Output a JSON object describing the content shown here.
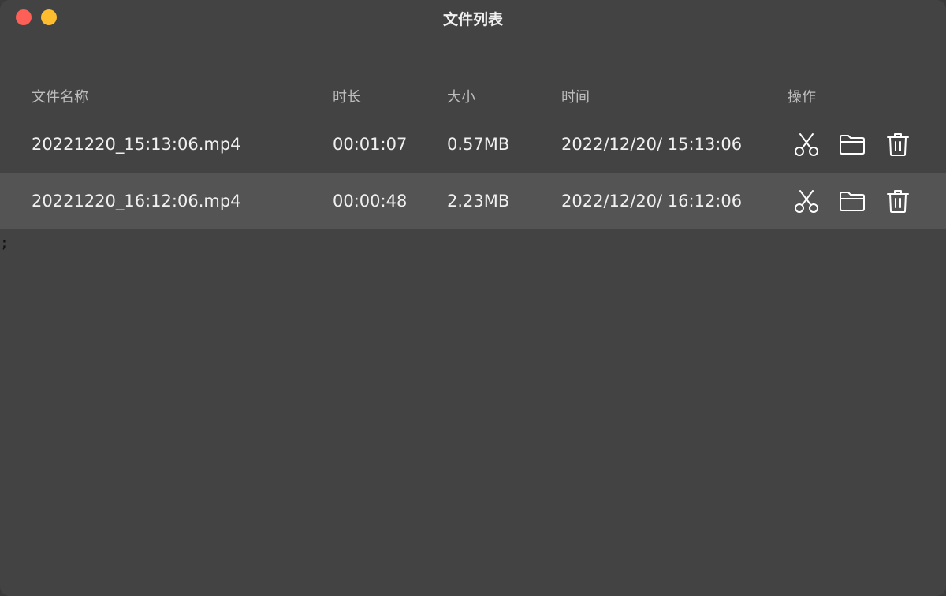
{
  "window": {
    "title": "文件列表"
  },
  "table": {
    "columns": {
      "name": "文件名称",
      "duration": "时长",
      "size": "大小",
      "time": "时间",
      "actions": "操作"
    },
    "rows": [
      {
        "name": "20221220_15:13:06.mp4",
        "duration": "00:01:07",
        "size": "0.57MB",
        "time": "2022/12/20/ 15:13:06"
      },
      {
        "name": "20221220_16:12:06.mp4",
        "duration": "00:00:48",
        "size": "2.23MB",
        "time": "2022/12/20/ 16:12:06"
      }
    ]
  },
  "stray_text": ";",
  "icons": {
    "cut": "scissors-icon",
    "folder": "folder-icon",
    "delete": "trash-icon"
  },
  "colors": {
    "background": "#434343",
    "selected_row": "#545454",
    "close": "#fe5f57",
    "minimize": "#febc2e"
  }
}
